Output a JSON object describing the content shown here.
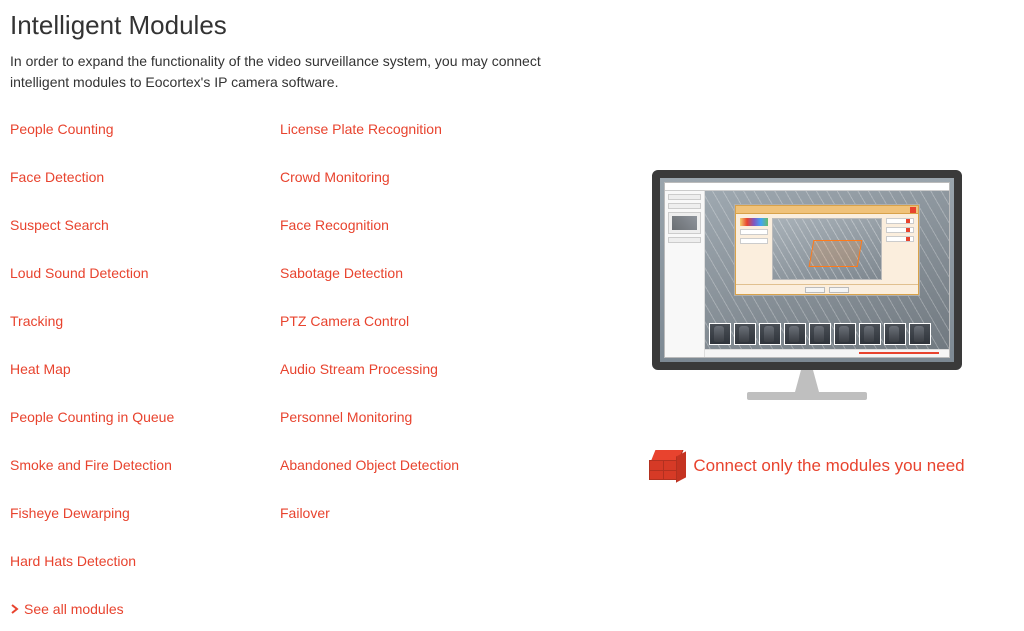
{
  "heading": "Intelligent Modules",
  "intro": "In order to expand the functionality of the video surveillance system, you may connect intelligent modules to Eocortex's IP camera software.",
  "modules_col1": [
    "People Counting",
    "Face Detection",
    "Suspect Search",
    "Loud Sound Detection",
    "Tracking",
    "Heat Map",
    "People Counting in Queue",
    "Smoke and Fire Detection",
    "Fisheye Dewarping",
    "Hard Hats Detection"
  ],
  "modules_col2": [
    "License Plate Recognition",
    "Crowd Monitoring",
    "Face Recognition",
    "Sabotage Detection",
    "PTZ Camera Control",
    "Audio Stream Processing",
    "Personnel Monitoring",
    "Abandoned Object Detection",
    "Failover"
  ],
  "see_all_label": "See all modules",
  "tagline": "Connect only the modules you need",
  "colors": {
    "accent": "#e8432e"
  }
}
